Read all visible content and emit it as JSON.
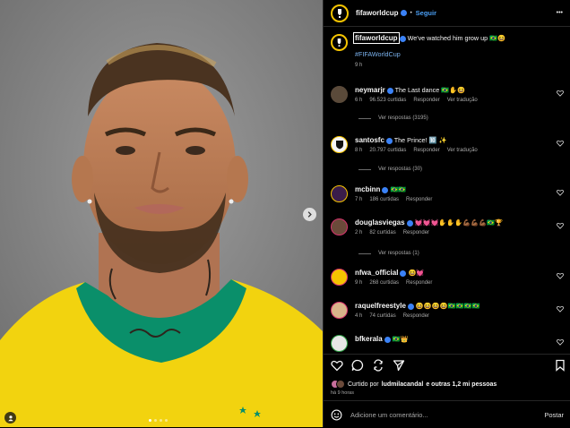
{
  "header": {
    "username": "fifaworldcup",
    "separator": "•",
    "follow_label": "Seguir",
    "more_label": "•••"
  },
  "caption": {
    "username": "fifaworldcup",
    "text": "We've watched him grow up 🇧🇷😆",
    "hashtag": "#FIFAWorldCup",
    "time": "9 h"
  },
  "comments": [
    {
      "user": "neymarjr",
      "text": "The Last dance 🇧🇷✋😆",
      "time": "6 h",
      "likes": "96.523 curtidas",
      "reply": "Responder",
      "translate": "Ver tradução",
      "view_replies": "Ver respostas (3195)"
    },
    {
      "user": "santosfc",
      "text": "The Prince! 🔟 ✨",
      "time": "8 h",
      "likes": "20.797 curtidas",
      "reply": "Responder",
      "translate": "Ver tradução",
      "view_replies": "Ver respostas (30)"
    },
    {
      "user": "mcbinn",
      "text": "🇧🇷🇧🇷",
      "time": "7 h",
      "likes": "186 curtidas",
      "reply": "Responder"
    },
    {
      "user": "douglasviegas",
      "text": "💓💓💓✋✋✋💪🏾💪🏾💪🏾🇧🇷🏆",
      "time": "2 h",
      "likes": "82 curtidas",
      "reply": "Responder",
      "view_replies": "Ver respostas (1)"
    },
    {
      "user": "nfwa_official",
      "text": "😆💓",
      "time": "9 h",
      "likes": "268 curtidas",
      "reply": "Responder"
    },
    {
      "user": "raquelfreestyle",
      "text": "😆😆😆😆🇧🇷🇧🇷🇧🇷🇧🇷",
      "time": "4 h",
      "likes": "74 curtidas",
      "reply": "Responder"
    },
    {
      "user": "bfkerala",
      "text": "🇧🇷👑"
    }
  ],
  "footer": {
    "liked_prefix": "Curtido por",
    "liked_user": "ludmilacandal",
    "liked_suffix": "e outras 1,2 mi pessoas",
    "ago": "há 9 horas",
    "comment_placeholder": "Adicione um comentário...",
    "post_label": "Postar"
  },
  "colors": {
    "jersey_yellow": "#f2d30f",
    "collar_green": "#0a8f6a",
    "background_gray": "#8a8a8a",
    "follow_blue": "#4a9ff5"
  },
  "icons": [
    "heart-icon",
    "comment-icon",
    "share-icon",
    "send-icon",
    "bookmark-icon",
    "emoji-icon",
    "chevron-right-icon",
    "tag-user-icon"
  ]
}
